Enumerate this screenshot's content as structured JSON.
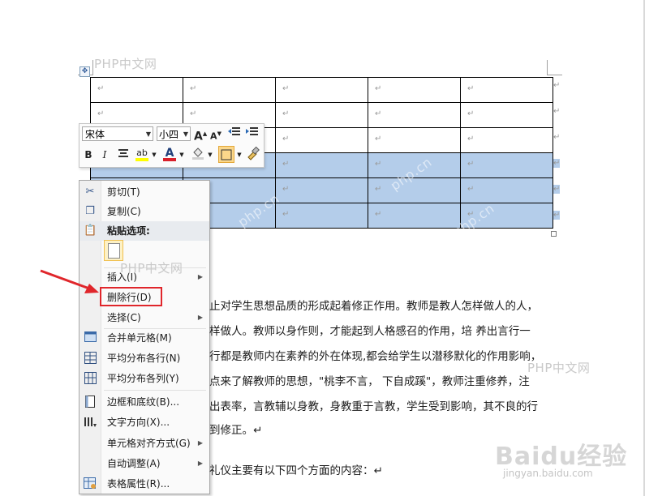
{
  "watermarks": {
    "top": "PHP中文网",
    "middle": "PHP中文网",
    "right": "PHP中文网",
    "diagonal": "php.cn"
  },
  "table": {
    "para_mark": "↵",
    "rows": 6,
    "cols": 5,
    "selected_rows": [
      3,
      4,
      5
    ]
  },
  "mini_toolbar": {
    "font_name": "宋体",
    "font_size": "小四",
    "grow_font": "A",
    "shrink_font": "A",
    "bold": "B",
    "italic": "I",
    "highlight": "ab",
    "font_color": "A",
    "colors": {
      "font_color": "#d9202a",
      "highlight": "#ffff00"
    }
  },
  "context_menu": {
    "items": [
      {
        "label": "剪切(T)",
        "icon": "scissors-icon"
      },
      {
        "label": "复制(C)",
        "icon": "copy-icon"
      },
      {
        "label": "粘贴选项:",
        "icon": "paste-icon"
      },
      {
        "label": "插入(I)",
        "submenu": true
      },
      {
        "label": "删除行(D)"
      },
      {
        "label": "选择(C)",
        "submenu": true
      },
      {
        "label": "合并单元格(M)",
        "icon": "merge-cells-icon"
      },
      {
        "label": "平均分布各行(N)",
        "icon": "distribute-rows-icon"
      },
      {
        "label": "平均分布各列(Y)",
        "icon": "distribute-columns-icon"
      },
      {
        "label": "边框和底纹(B)...",
        "icon": "borders-icon"
      },
      {
        "label": "文字方向(X)...",
        "icon": "text-direction-icon"
      },
      {
        "label": "单元格对齐方式(G)",
        "submenu": true
      },
      {
        "label": "自动调整(A)",
        "submenu": true
      },
      {
        "label": "表格属性(R)...",
        "icon": "table-properties-icon"
      }
    ],
    "highlight_color": "#e0262b"
  },
  "body_text": {
    "line1": "止对学生思想品质的形成起着修正作用。教师是教人怎样做人的人，",
    "line2": "样做人。教师以身作则，才能起到人格感召的作用，培  养出言行一",
    "line3": "行都是教师内在素养的外在体现,都会给学生以潜移默化的作用影响，",
    "line4": "点来了解教师的思想，\"桃李不言，  下自成蹊\"，教师注重修养，注",
    "line5": "出表率，言教辅以身教，身教重于言教，学生受到影响，其不良的行",
    "line6": "到修正。↵",
    "line7": "礼仪主要有以下四个方面的内容：↵"
  },
  "baidu": {
    "logo_text": "Baidu经验",
    "url": "jingyan.baidu.com"
  }
}
